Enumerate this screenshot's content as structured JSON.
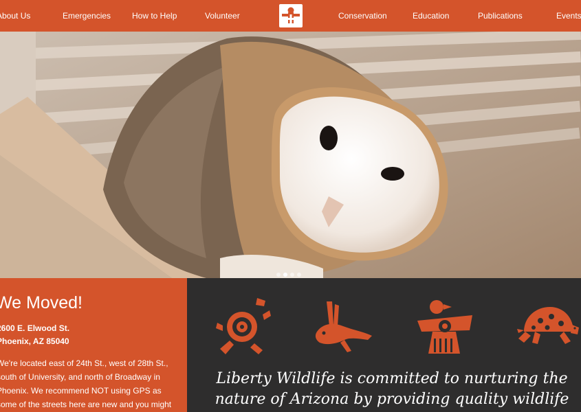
{
  "nav": {
    "left_items": [
      "About Us",
      "Emergencies",
      "How to Help",
      "Volunteer"
    ],
    "right_items": [
      "Conservation",
      "Education",
      "Publications",
      "Events"
    ],
    "brand_color": "#d4542b"
  },
  "hero": {
    "slides_visible": 4,
    "active_slide": 1
  },
  "moved": {
    "title": "We Moved!",
    "street": "2600 E. Elwood St.",
    "city": "Phoenix, AZ 85040",
    "description": "We're located east of 24th St., west of 28th St., south of University, and north of Broadway in Phoenix. We recommend NOT using GPS as some of the streets here are new and you might"
  },
  "icons": [
    "lizard-icon",
    "rabbit-icon",
    "thunderbird-icon",
    "turtle-icon"
  ],
  "mission": "Liberty Wildlife is committed to nurturing the nature of Arizona by providing quality wildlife rehabilitation, environmental"
}
